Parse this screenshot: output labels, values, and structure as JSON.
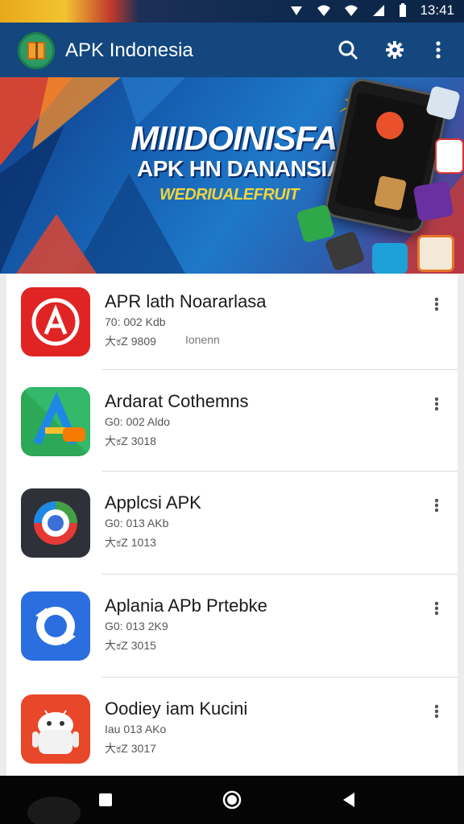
{
  "status_bar": {
    "time": "13:41"
  },
  "app_bar": {
    "title": "APK Indonesia"
  },
  "banner": {
    "headline": "MIIIDOINISFA",
    "subhead": "APK HN DANANSIA",
    "tagline": "WEDRIUALEFRUIT"
  },
  "apps": [
    {
      "name": "APR lath Noararlasa",
      "size": "70: 002 Kdb",
      "stat": "大ಕZ 9809",
      "extra": "Ionenn",
      "icon": "red-a-icon"
    },
    {
      "name": "Ardarat Cothemns",
      "size": "G0: 002 Aldo",
      "stat": "大ಕZ 3018",
      "extra": "",
      "icon": "green-a-icon"
    },
    {
      "name": "Applcsi APK",
      "size": "G0: 013 AKb",
      "stat": "大ಕZ 1013",
      "extra": "",
      "icon": "colorful-circle-icon"
    },
    {
      "name": "Aplania APb Prtebke",
      "size": "G0: 013 2K9",
      "stat": "大ಕZ 3015",
      "extra": "",
      "icon": "blue-arrows-icon"
    },
    {
      "name": "Oodiey iam Kucini",
      "size": "Iau 013 AKo",
      "stat": "大ಕZ 3017",
      "extra": "",
      "icon": "android-robot-icon"
    }
  ],
  "colors": {
    "appbar": "#13477e",
    "banner_accent": "#f3d53a"
  }
}
